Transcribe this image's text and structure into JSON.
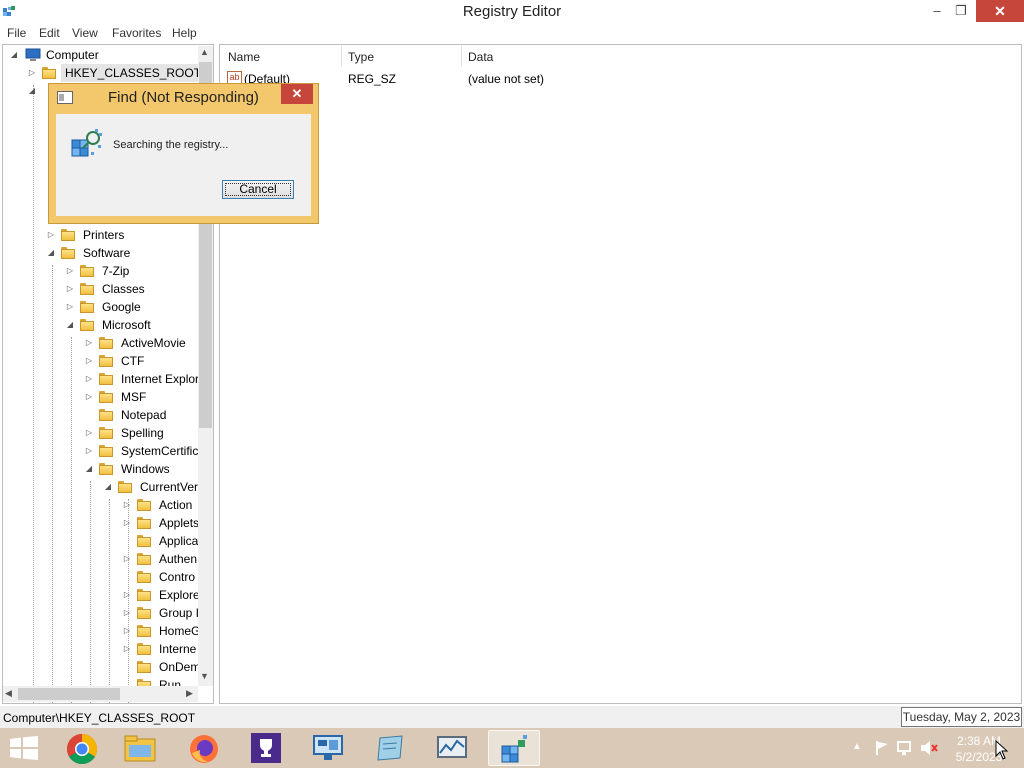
{
  "window": {
    "title": "Registry Editor",
    "controls": {
      "minimize": "–",
      "restore": "❐",
      "close": "✕"
    }
  },
  "menu": [
    "File",
    "Edit",
    "View",
    "Favorites",
    "Help"
  ],
  "tree": {
    "root": "Computer",
    "nodes": [
      {
        "label": "HKEY_CLASSES_ROOT",
        "selected": true
      },
      {
        "label": "Printers"
      },
      {
        "label": "Software"
      },
      {
        "label": "7-Zip"
      },
      {
        "label": "Classes"
      },
      {
        "label": "Google"
      },
      {
        "label": "Microsoft"
      },
      {
        "label": "ActiveMovie"
      },
      {
        "label": "CTF"
      },
      {
        "label": "Internet Explor"
      },
      {
        "label": "MSF"
      },
      {
        "label": "Notepad"
      },
      {
        "label": "Spelling"
      },
      {
        "label": "SystemCertific"
      },
      {
        "label": "Windows"
      },
      {
        "label": "CurrentVer"
      },
      {
        "label": "Action"
      },
      {
        "label": "Applets"
      },
      {
        "label": "Applica"
      },
      {
        "label": "Authen"
      },
      {
        "label": "Contro"
      },
      {
        "label": "Explore"
      },
      {
        "label": "Group I"
      },
      {
        "label": "HomeG"
      },
      {
        "label": "Interne"
      },
      {
        "label": "OnDem"
      },
      {
        "label": "Run"
      }
    ]
  },
  "list": {
    "columns": [
      "Name",
      "Type",
      "Data"
    ],
    "rows": [
      {
        "icon": "ab",
        "name": "(Default)",
        "type": "REG_SZ",
        "data": "(value not set)"
      }
    ]
  },
  "status": {
    "path": "Computer\\HKEY_CLASSES_ROOT",
    "date_tooltip": "Tuesday, May 2, 2023"
  },
  "dialog": {
    "title": "Find (Not Responding)",
    "message": "Searching the registry...",
    "cancel_label": "Cancel",
    "close": "✕"
  },
  "taskbar": {
    "apps": [
      "start-icon",
      "chrome-icon",
      "file-explorer-icon",
      "firefox-icon",
      "trophy-app-icon",
      "remote-desktop-icon",
      "notepad-icon",
      "performance-monitor-icon",
      "regedit-icon"
    ],
    "clock_time": "2:38 AM",
    "clock_date": "5/2/2023",
    "tray_chevron": "▲"
  },
  "colors": {
    "dialog_frame": "#f3c76b",
    "close_button": "#c7463c",
    "taskbar": "#d9c9b6"
  }
}
